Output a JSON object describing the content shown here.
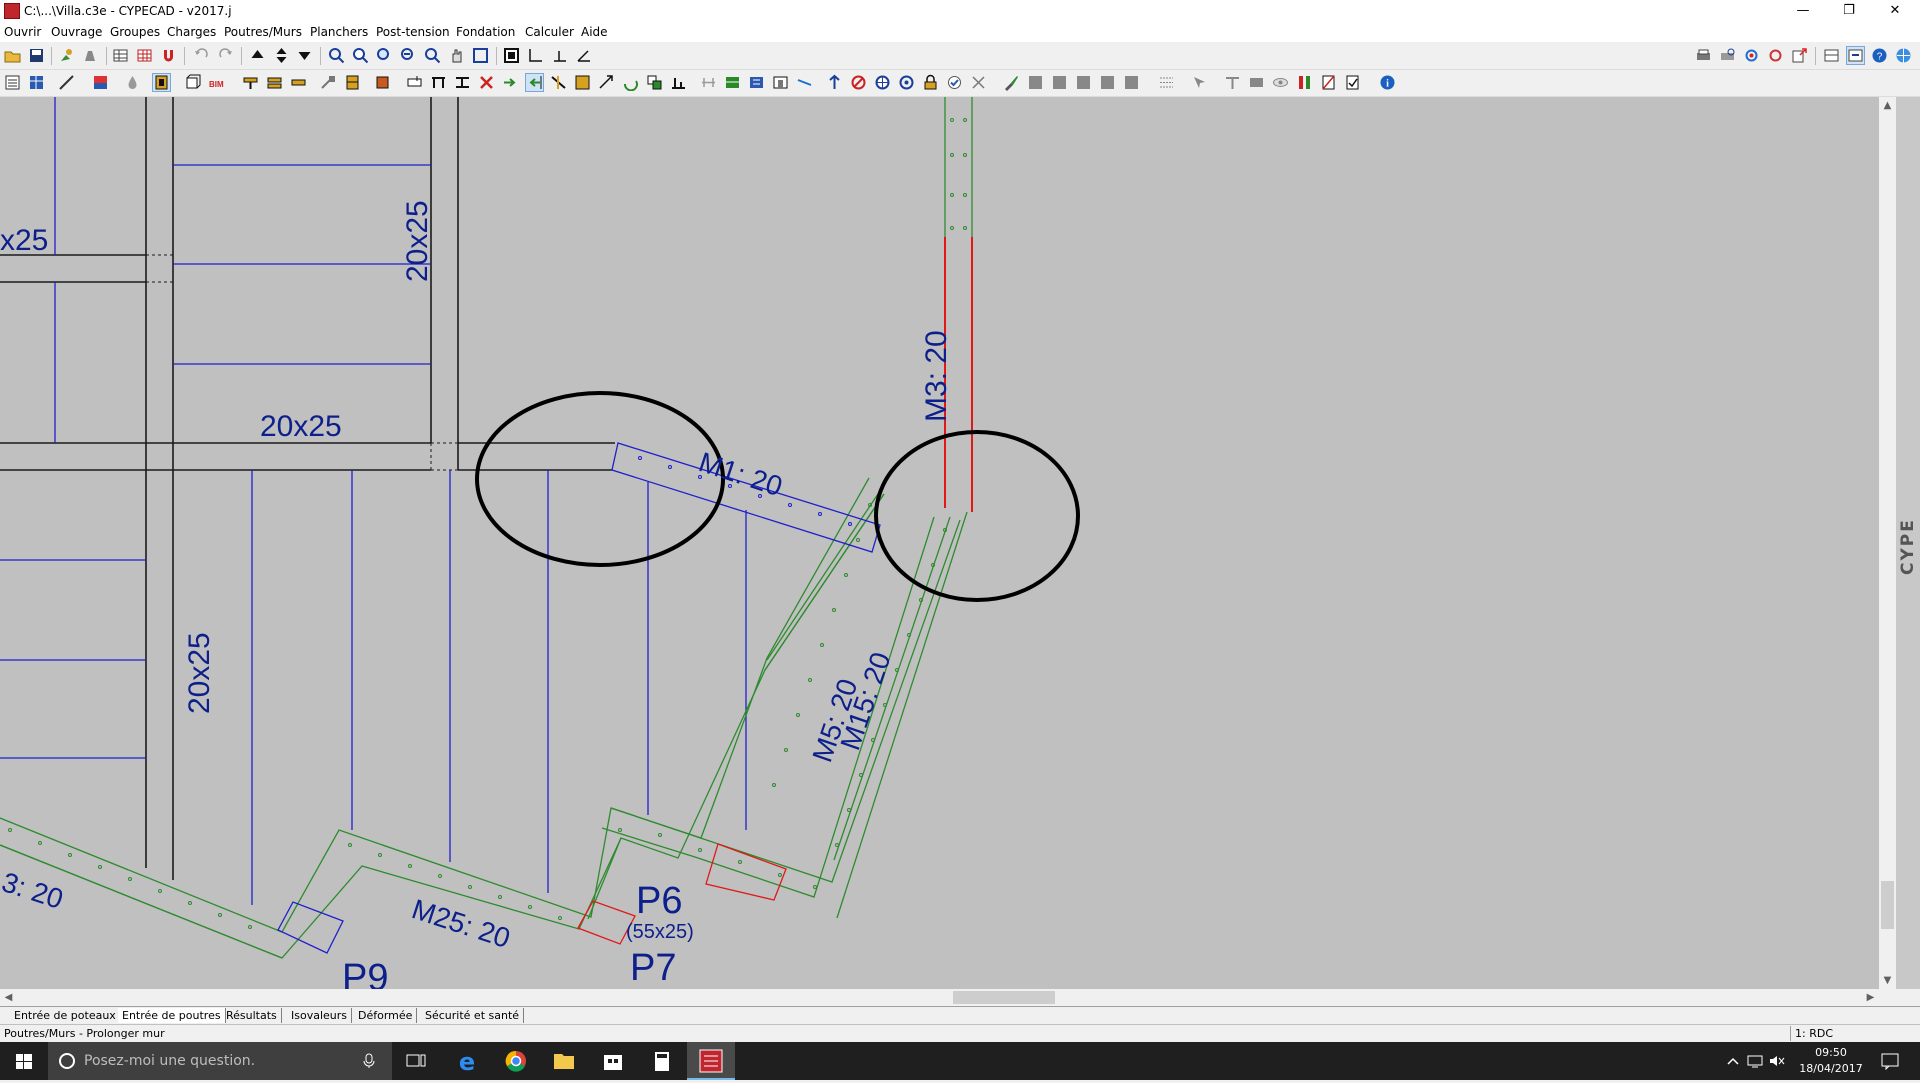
{
  "window": {
    "title": "C:\\...\\Villa.c3e - CYPECAD - v2017.j",
    "minimize_icon": "minimize-icon",
    "restore_icon": "restore-icon",
    "close_icon": "close-icon"
  },
  "menu": [
    "Ouvrir",
    "Ouvrage",
    "Groupes",
    "Charges",
    "Poutres/Murs",
    "Planchers",
    "Post-tension",
    "Fondation",
    "Calculer",
    "Aide"
  ],
  "drawing": {
    "labels": {
      "beam_left_top": "x25",
      "beam_vertical_top": "20x25",
      "beam_horizontal": "20x25",
      "beam_vertical_left": "20x25",
      "wall_m3": "M3: 20",
      "wall_m1": "M1: 20",
      "wall_m5": "M5: 20",
      "wall_m15": "M15: 20",
      "wall_m25": "M25: 20",
      "wall_bottom_left": "3: 20",
      "column_p6": "P6",
      "column_p6_size": "(55x25)",
      "column_p7": "P7",
      "column_p9": "P9"
    },
    "colors": {
      "background": "#c0c0c0",
      "beam_black": "#1a1a1a",
      "joist_blue": "#1f1fcc",
      "wall_green": "#2e8b2e",
      "wall_red": "#e01818",
      "label_blue": "#0c1f8a",
      "highlight_circle": "#000000"
    }
  },
  "side_label": "CYPE",
  "tabs": [
    "Entrée de poteaux",
    "Entrée de poutres",
    "Résultats",
    "Isovaleurs",
    "Déformée",
    "Sécurité et santé"
  ],
  "active_tab": "Entrée de poutres",
  "status": {
    "left": "Poutres/Murs - Prolonger mur",
    "right": "1: RDC"
  },
  "taskbar": {
    "search_placeholder": "Posez-moi une question.",
    "time": "09:50",
    "date": "18/04/2017",
    "icons": [
      "windows-start-icon",
      "microphone-icon",
      "task-view-icon",
      "edge-icon",
      "chrome-icon",
      "file-explorer-icon",
      "store-icon",
      "calculator-icon",
      "cypecad-icon"
    ]
  }
}
